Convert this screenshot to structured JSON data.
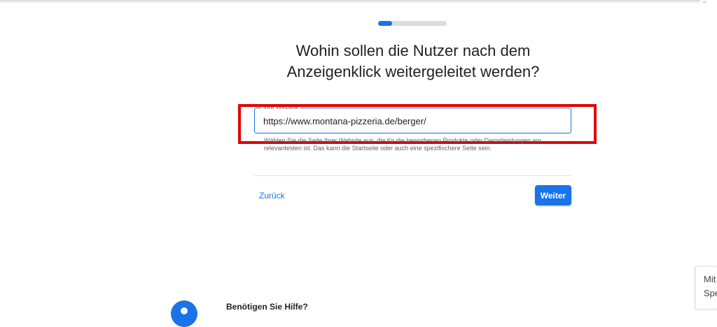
{
  "progress": {
    "fraction": 0.2
  },
  "title": {
    "line1": "Wohin sollen die Nutzer nach dem",
    "line2": "Anzeigenklick weitergeleitet werden?"
  },
  "website_field": {
    "label": "Ihre Website",
    "value": "https://www.montana-pizzeria.de/berger/"
  },
  "helper_text": "Wählen Sie die Seite Ihrer Website aus, die für die beworbenen Produkte oder Dienstleistungen am relevantesten ist. Das kann die Startseite oder auch eine spezifischere Seite sein.",
  "actions": {
    "back_label": "Zurück",
    "next_label": "Weiter"
  },
  "help": {
    "title": "Benötigen Sie Hilfe?",
    "icon": "help-circle-icon"
  },
  "side_panel": {
    "line1": "Mit",
    "line2": "Spe"
  },
  "colors": {
    "accent": "#1a73e8",
    "highlight_frame": "#e00000"
  }
}
